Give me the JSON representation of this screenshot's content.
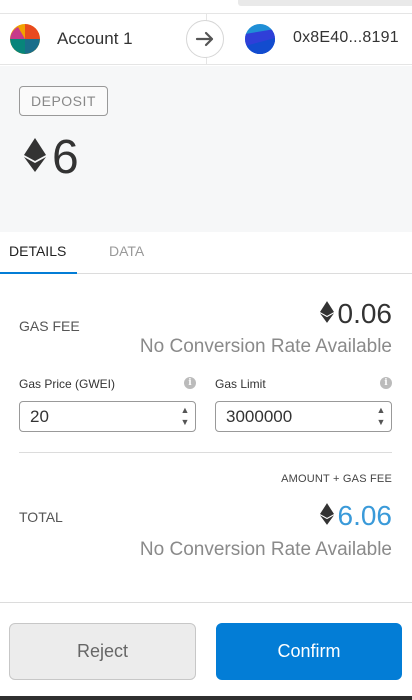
{
  "from": {
    "name": "Account 1",
    "avatar_icon": "account-identicon"
  },
  "to": {
    "address": "0x8E40...8191",
    "avatar_icon": "recipient-identicon"
  },
  "arrow_icon": "arrow-right-icon",
  "summary": {
    "badge": "DEPOSIT",
    "amount": "6",
    "currency_icon": "eth-icon"
  },
  "tabs": [
    {
      "label": "DETAILS",
      "active": true
    },
    {
      "label": "DATA",
      "active": false
    }
  ],
  "gas": {
    "label": "GAS FEE",
    "value": "0.06",
    "conversion": "No Conversion Rate Available",
    "price_label": "Gas Price (GWEI)",
    "price_value": "20",
    "limit_label": "Gas Limit",
    "limit_value": "3000000"
  },
  "total": {
    "hint": "AMOUNT + GAS FEE",
    "label": "TOTAL",
    "value": "6.06",
    "conversion": "No Conversion Rate Available"
  },
  "buttons": {
    "reject": "Reject",
    "confirm": "Confirm"
  },
  "colors": {
    "accent": "#037dd6",
    "total": "#3a9ad9"
  }
}
